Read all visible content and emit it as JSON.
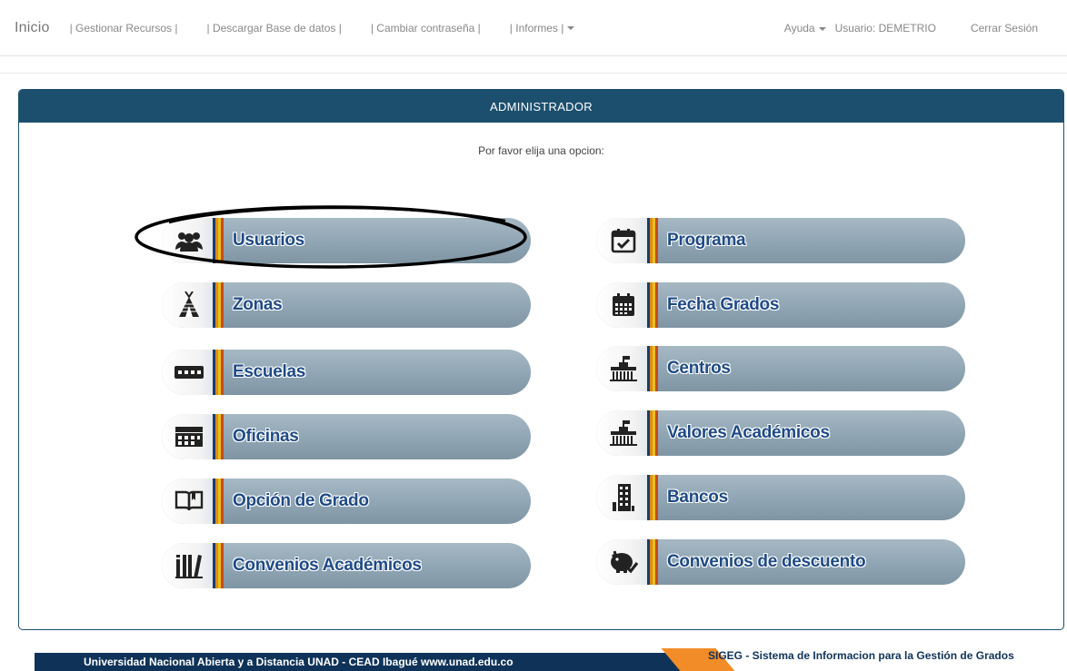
{
  "nav": {
    "brand": "Inicio",
    "links": [
      "| Gestionar Recursos |",
      "| Descargar Base de datos |",
      "| Cambiar contraseña |",
      "| Informes |"
    ],
    "help": "Ayuda",
    "user": "Usuario: DEMETRIO",
    "logout": "Cerrar Sesión"
  },
  "panel": {
    "title": "ADMINISTRADOR",
    "prompt": "Por favor elija una opcion:"
  },
  "menu_left": [
    {
      "label": "Usuarios",
      "icon": "users-icon"
    },
    {
      "label": "Zonas",
      "icon": "tent-icon"
    },
    {
      "label": "Escuelas",
      "icon": "school-icon"
    },
    {
      "label": "Oficinas",
      "icon": "office-icon"
    },
    {
      "label": "Opción de Grado",
      "icon": "book-icon"
    },
    {
      "label": "Convenios Académicos",
      "icon": "library-icon"
    }
  ],
  "menu_right": [
    {
      "label": "Programa",
      "icon": "calendar-check-icon"
    },
    {
      "label": "Fecha Grados",
      "icon": "calendar-icon"
    },
    {
      "label": "Centros",
      "icon": "building-icon"
    },
    {
      "label": "Valores Académicos",
      "icon": "building-icon"
    },
    {
      "label": "Bancos",
      "icon": "bank-icon"
    },
    {
      "label": "Convenios de descuento",
      "icon": "piggy-bank-icon"
    }
  ],
  "footer": {
    "left": "Universidad Nacional Abierta y a Distancia UNAD - CEAD Ibagué  www.unad.edu.co",
    "right": "SIGEG - Sistema de Informacion para la Gestión de Grados"
  },
  "colors": {
    "panel_header": "#1c4f6e",
    "button_fill": "#8fa5b3",
    "label_text": "#1f4a86",
    "footer_navy": "#0f3358",
    "footer_orange": "#f28c28"
  }
}
